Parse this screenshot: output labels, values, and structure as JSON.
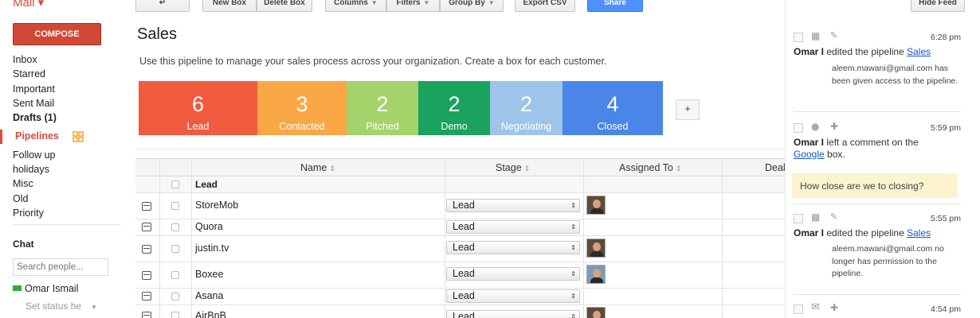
{
  "app": {
    "logo": "Mail ▾"
  },
  "toolbar": {
    "back_label": "↵",
    "new_box": "New Box",
    "delete_box": "Delete Box",
    "columns": "Columns",
    "filters": "Filters",
    "group_by": "Group By",
    "export_csv": "Export CSV",
    "share": "Share",
    "hide_feed": "Hide Feed"
  },
  "sidebar": {
    "compose": "COMPOSE",
    "items": [
      {
        "label": "Inbox",
        "bold": false
      },
      {
        "label": "Starred",
        "bold": false
      },
      {
        "label": "Important",
        "bold": false
      },
      {
        "label": "Sent Mail",
        "bold": false
      },
      {
        "label": "Drafts (1)",
        "bold": true
      }
    ],
    "pipelines_label": "Pipelines",
    "pipelines": [
      {
        "label": "Follow up"
      },
      {
        "label": "holidays"
      },
      {
        "label": "Misc"
      },
      {
        "label": "Old"
      },
      {
        "label": "Priority"
      }
    ],
    "chat": {
      "heading": "Chat",
      "search_placeholder": "Search people...",
      "user": "Omar Ismail",
      "status": "Set status he"
    }
  },
  "main": {
    "title": "Sales",
    "description": "Use this pipeline to manage your sales process across your organization. Create a box for each customer.",
    "stages": [
      {
        "count": "6",
        "label": "Lead",
        "color": "#f05a3f"
      },
      {
        "count": "3",
        "label": "Contacted",
        "color": "#faa845"
      },
      {
        "count": "2",
        "label": "Pitched",
        "color": "#a3d36a"
      },
      {
        "count": "2",
        "label": "Demo",
        "color": "#19a35e"
      },
      {
        "count": "2",
        "label": "Negotiating",
        "color": "#9ec5e9"
      },
      {
        "count": "4",
        "label": "Closed",
        "color": "#4a86e8"
      }
    ],
    "add_stage": "+",
    "columns": [
      "Name",
      "Stage",
      "Assigned To",
      "Deal"
    ],
    "group_label": "Lead",
    "rows": [
      {
        "name": "StoreMob",
        "stage": "Lead"
      },
      {
        "name": "Quora",
        "stage": "Lead"
      },
      {
        "name": "justin.tv",
        "stage": "Lead"
      },
      {
        "name": "Boxee",
        "stage": "Lead"
      },
      {
        "name": "Asana",
        "stage": "Lead"
      },
      {
        "name": "AirBnB",
        "stage": "Lead"
      }
    ]
  },
  "feed": {
    "entries": [
      {
        "time": "6:28 pm",
        "actor": "Omar I",
        "action": " edited the pipeline ",
        "link": "Sales",
        "detail": "aleem.mawani@gmail.com has been given access to the pipeline."
      },
      {
        "time": "5:59 pm",
        "actor": "Omar I",
        "action": " left a comment on the",
        "link": "Google",
        "link_suffix": " box.",
        "comment": "How close are we to closing?"
      },
      {
        "time": "5:55 pm",
        "actor": "Omar I",
        "action": " edited the pipeline ",
        "link": "Sales",
        "detail": "aleem.mawani@gmail.com no longer has permission to the pipeline."
      },
      {
        "time": "4:54 pm"
      }
    ]
  }
}
